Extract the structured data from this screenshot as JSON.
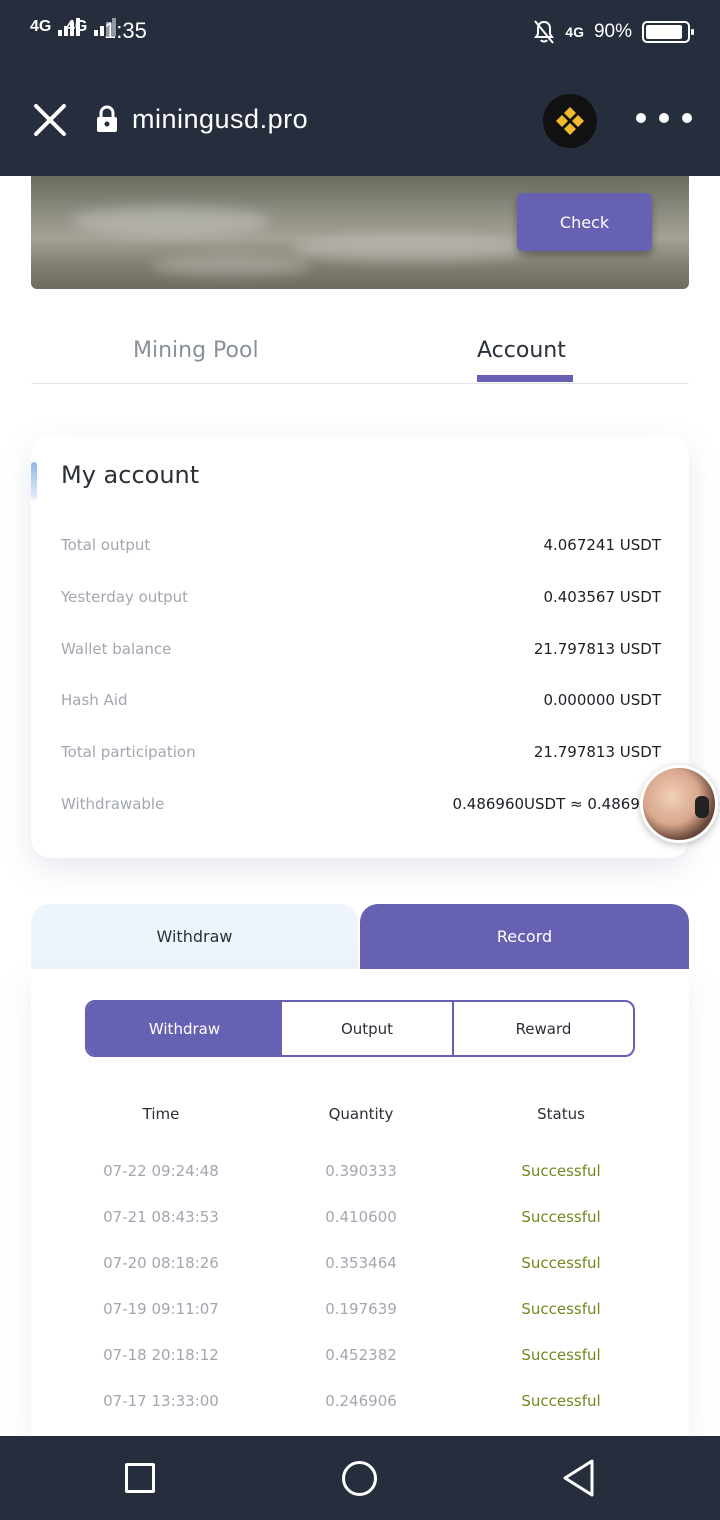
{
  "status_bar": {
    "signal1": "4G",
    "signal2": "4G",
    "time": "1:35",
    "network": "4G",
    "battery": "90%",
    "battery_level": 0.9
  },
  "browser": {
    "url": "miningusd.pro",
    "close_icon": "close-icon",
    "lock_icon": "lock-icon",
    "menu_icon": "more-dots-icon"
  },
  "banner": {
    "check_label": "Check"
  },
  "main_tabs": [
    {
      "label": "Mining Pool",
      "active": false
    },
    {
      "label": "Account",
      "active": true
    }
  ],
  "account": {
    "title": "My account",
    "rows": [
      {
        "label": "Total output",
        "value": "4.067241 USDT"
      },
      {
        "label": "Yesterday output",
        "value": "0.403567 USDT"
      },
      {
        "label": "Wallet balance",
        "value": "21.797813 USDT"
      },
      {
        "label": "Hash Aid",
        "value": "0.000000 USDT"
      },
      {
        "label": "Total participation",
        "value": "21.797813 USDT"
      },
      {
        "label": "Withdrawable",
        "value": "0.486960USDT ≈ 0.486960USD"
      }
    ]
  },
  "section_tabs": [
    {
      "label": "Withdraw",
      "active": false
    },
    {
      "label": "Record",
      "active": true
    }
  ],
  "record": {
    "segments": [
      {
        "label": "Withdraw",
        "active": true
      },
      {
        "label": "Output",
        "active": false
      },
      {
        "label": "Reward",
        "active": false
      }
    ],
    "columns": [
      "Time",
      "Quantity",
      "Status"
    ],
    "rows": [
      {
        "time": "07-22 09:24:48",
        "quantity": "0.390333",
        "status": "Successful"
      },
      {
        "time": "07-21 08:43:53",
        "quantity": "0.410600",
        "status": "Successful"
      },
      {
        "time": "07-20 08:18:26",
        "quantity": "0.353464",
        "status": "Successful"
      },
      {
        "time": "07-19 09:11:07",
        "quantity": "0.197639",
        "status": "Successful"
      },
      {
        "time": "07-18 20:18:12",
        "quantity": "0.452382",
        "status": "Successful"
      },
      {
        "time": "07-17 13:33:00",
        "quantity": "0.246906",
        "status": "Successful"
      }
    ]
  },
  "colors": {
    "accent": "#6661b3",
    "dark_bar": "#262e3e",
    "success": "#6e8a1e",
    "muted_text": "#a2a6b1"
  }
}
